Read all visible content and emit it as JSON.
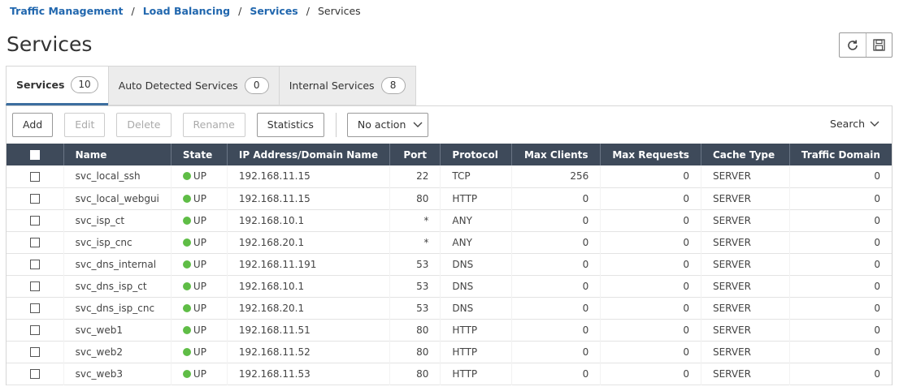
{
  "breadcrumb": {
    "items": [
      "Traffic Management",
      "Load Balancing",
      "Services"
    ],
    "separator": "/",
    "current": "Services"
  },
  "page": {
    "title": "Services"
  },
  "tabs": [
    {
      "label": "Services",
      "count": "10"
    },
    {
      "label": "Auto Detected Services",
      "count": "0"
    },
    {
      "label": "Internal Services",
      "count": "8"
    }
  ],
  "toolbar": {
    "add": "Add",
    "edit": "Edit",
    "delete": "Delete",
    "rename": "Rename",
    "statistics": "Statistics",
    "action_select": "No action",
    "search": "Search"
  },
  "table": {
    "columns": [
      "Name",
      "State",
      "IP Address/Domain Name",
      "Port",
      "Protocol",
      "Max Clients",
      "Max Requests",
      "Cache Type",
      "Traffic Domain"
    ],
    "rows": [
      {
        "name": "svc_local_ssh",
        "state": "UP",
        "ip": "192.168.11.15",
        "port": "22",
        "protocol": "TCP",
        "max_clients": "256",
        "max_requests": "0",
        "cache_type": "SERVER",
        "traffic_domain": "0"
      },
      {
        "name": "svc_local_webgui",
        "state": "UP",
        "ip": "192.168.11.15",
        "port": "80",
        "protocol": "HTTP",
        "max_clients": "0",
        "max_requests": "0",
        "cache_type": "SERVER",
        "traffic_domain": "0"
      },
      {
        "name": "svc_isp_ct",
        "state": "UP",
        "ip": "192.168.10.1",
        "port": "*",
        "protocol": "ANY",
        "max_clients": "0",
        "max_requests": "0",
        "cache_type": "SERVER",
        "traffic_domain": "0"
      },
      {
        "name": "svc_isp_cnc",
        "state": "UP",
        "ip": "192.168.20.1",
        "port": "*",
        "protocol": "ANY",
        "max_clients": "0",
        "max_requests": "0",
        "cache_type": "SERVER",
        "traffic_domain": "0"
      },
      {
        "name": "svc_dns_internal",
        "state": "UP",
        "ip": "192.168.11.191",
        "port": "53",
        "protocol": "DNS",
        "max_clients": "0",
        "max_requests": "0",
        "cache_type": "SERVER",
        "traffic_domain": "0"
      },
      {
        "name": "svc_dns_isp_ct",
        "state": "UP",
        "ip": "192.168.10.1",
        "port": "53",
        "protocol": "DNS",
        "max_clients": "0",
        "max_requests": "0",
        "cache_type": "SERVER",
        "traffic_domain": "0"
      },
      {
        "name": "svc_dns_isp_cnc",
        "state": "UP",
        "ip": "192.168.20.1",
        "port": "53",
        "protocol": "DNS",
        "max_clients": "0",
        "max_requests": "0",
        "cache_type": "SERVER",
        "traffic_domain": "0"
      },
      {
        "name": "svc_web1",
        "state": "UP",
        "ip": "192.168.11.51",
        "port": "80",
        "protocol": "HTTP",
        "max_clients": "0",
        "max_requests": "0",
        "cache_type": "SERVER",
        "traffic_domain": "0"
      },
      {
        "name": "svc_web2",
        "state": "UP",
        "ip": "192.168.11.52",
        "port": "80",
        "protocol": "HTTP",
        "max_clients": "0",
        "max_requests": "0",
        "cache_type": "SERVER",
        "traffic_domain": "0"
      },
      {
        "name": "svc_web3",
        "state": "UP",
        "ip": "192.168.11.53",
        "port": "80",
        "protocol": "HTTP",
        "max_clients": "0",
        "max_requests": "0",
        "cache_type": "SERVER",
        "traffic_domain": "0"
      }
    ]
  },
  "colors": {
    "link": "#2167ae",
    "header_bg": "#3e4a5a",
    "state_up": "#5fbd46",
    "tab_active_border": "#3c6e9f"
  },
  "icons": [
    "refresh-icon",
    "save-icon",
    "chevron-down-icon",
    "status-up-icon",
    "checkbox-icon"
  ]
}
